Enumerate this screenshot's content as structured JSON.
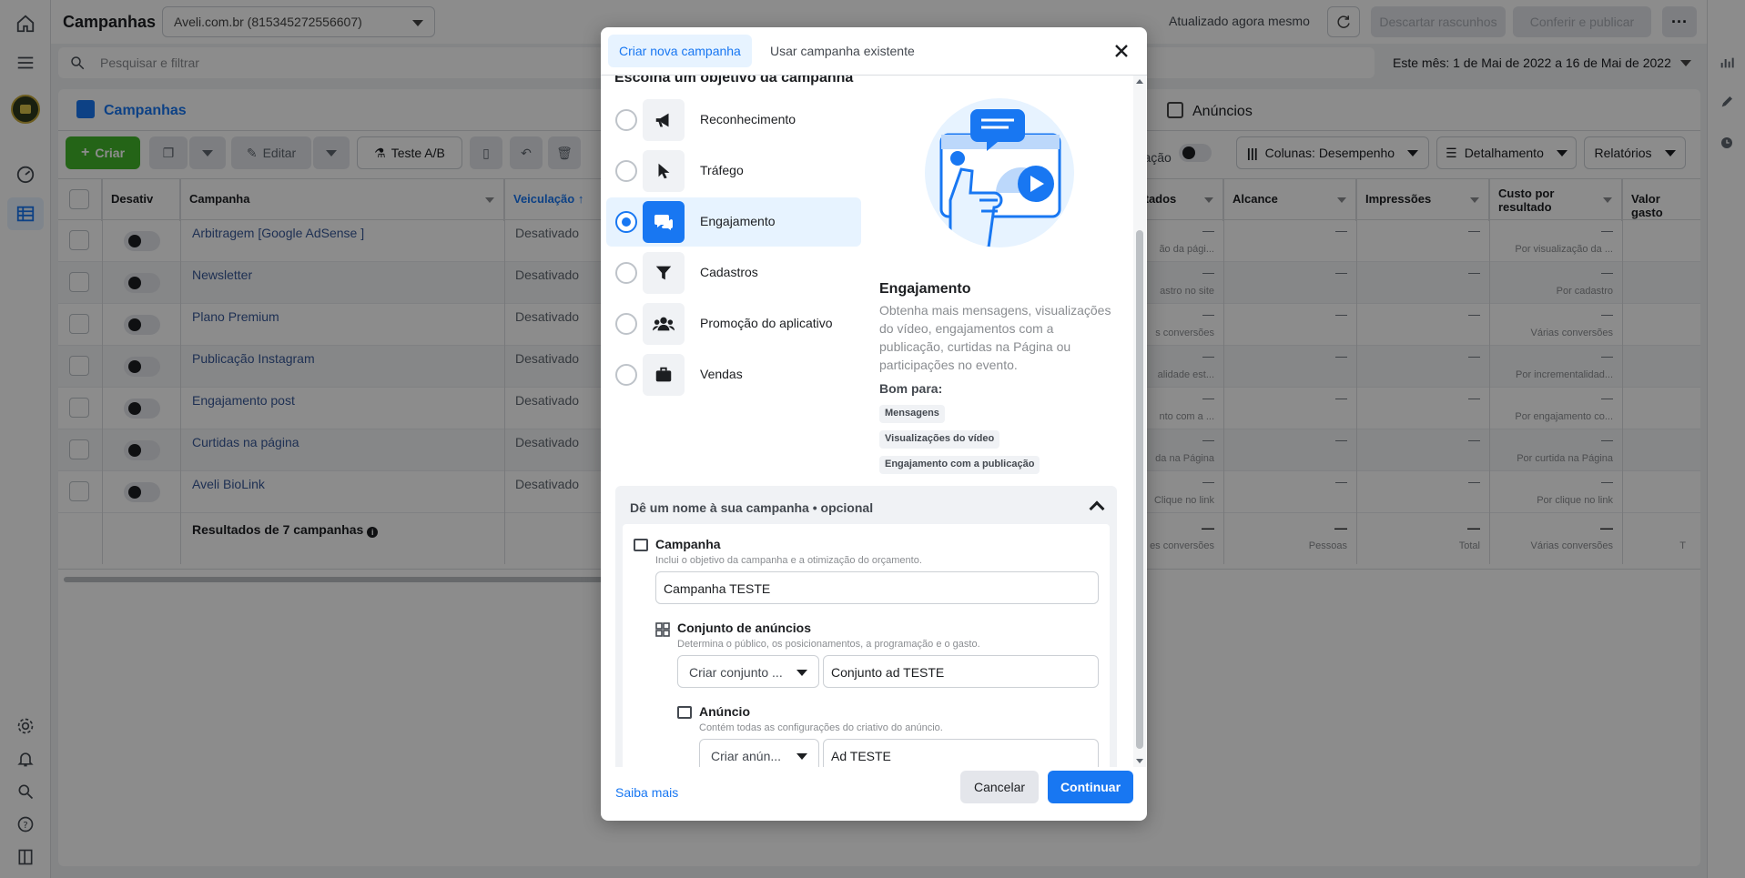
{
  "header": {
    "title": "Campanhas",
    "account": "Aveli.com.br (815345272556607)",
    "updated": "Atualizado agora mesmo",
    "discard": "Descartar rascunhos",
    "review": "Conferir e publicar"
  },
  "search": {
    "placeholder": "Pesquisar e filtrar"
  },
  "date_range": "Este mês: 1 de Mai de 2022 a 16 de Mai de 2022",
  "tabs": {
    "campaigns": "Campanhas",
    "ads": "Anúncios"
  },
  "toolbar": {
    "create": "Criar",
    "edit": "Editar",
    "ab_test": "Teste A/B",
    "duration_fragment": "uração",
    "columns": "Colunas: Desempenho",
    "breakdown": "Detalhamento",
    "reports": "Relatórios"
  },
  "table": {
    "headers": {
      "off": "Desativ",
      "campaign": "Campanha",
      "delivery": "Veiculação",
      "results": "ltados",
      "reach": "Alcance",
      "impressions": "Impressões",
      "cost_per": "Custo por resultado",
      "spent": "Valor gasto"
    },
    "rows": [
      {
        "name": "Arbitragem [Google AdSense ]",
        "delivery": "Desativado",
        "res": "—",
        "res_sub": "ão da pági...",
        "reach": "—",
        "impr": "—",
        "cost": "—",
        "cost_sub": "Por visualização da ..."
      },
      {
        "name": "Newsletter",
        "delivery": "Desativado",
        "res": "—",
        "res_sub": "astro no site",
        "reach": "—",
        "impr": "—",
        "cost": "—",
        "cost_sub": "Por cadastro"
      },
      {
        "name": "Plano Premium",
        "delivery": "Desativado",
        "res": "—",
        "res_sub": "s conversões",
        "reach": "—",
        "impr": "—",
        "cost": "—",
        "cost_sub": "Várias conversões"
      },
      {
        "name": "Publicação Instagram",
        "delivery": "Desativado",
        "res": "—",
        "res_sub": "alidade est...",
        "reach": "—",
        "impr": "—",
        "cost": "—",
        "cost_sub": "Por incrementalidad..."
      },
      {
        "name": "Engajamento post",
        "delivery": "Desativado",
        "res": "—",
        "res_sub": "nto com a ...",
        "reach": "—",
        "impr": "—",
        "cost": "—",
        "cost_sub": "Por engajamento co..."
      },
      {
        "name": "Curtidas na página",
        "delivery": "Desativado",
        "res": "—",
        "res_sub": "da na Página",
        "reach": "—",
        "impr": "—",
        "cost": "—",
        "cost_sub": "Por curtida na Página"
      },
      {
        "name": "Aveli BioLink",
        "delivery": "Desativado",
        "res": "—",
        "res_sub": "Clique no link",
        "reach": "—",
        "impr": "—",
        "cost": "—",
        "cost_sub": "Por clique no link"
      }
    ],
    "summary": {
      "label": "Resultados de 7 campanhas",
      "res": "—",
      "res_sub": "es conversões",
      "reach": "—",
      "reach_sub": "Pessoas",
      "impr": "—",
      "impr_sub": "Total",
      "cost": "—",
      "cost_sub": "Várias conversões",
      "spent_sub": "T"
    }
  },
  "modal": {
    "tab_new": "Criar nova campanha",
    "tab_existing": "Usar campanha existente",
    "objective_heading": "Escolha um objetivo da campanha",
    "objectives": [
      {
        "label": "Reconhecimento",
        "icon": "megaphone-icon"
      },
      {
        "label": "Tráfego",
        "icon": "cursor-icon"
      },
      {
        "label": "Engajamento",
        "icon": "chat-icon",
        "selected": true
      },
      {
        "label": "Cadastros",
        "icon": "funnel-icon"
      },
      {
        "label": "Promoção do aplicativo",
        "icon": "people-icon"
      },
      {
        "label": "Vendas",
        "icon": "briefcase-icon"
      }
    ],
    "detail": {
      "title": "Engajamento",
      "description": "Obtenha mais mensagens, visualizações do vídeo, engajamentos com a publicação, curtidas na Página ou participações no evento.",
      "good_for": "Bom para:",
      "chips": [
        "Mensagens",
        "Visualizações do vídeo",
        "Engajamento com a publicação"
      ]
    },
    "naming": {
      "heading": "Dê um nome à sua campanha • opcional",
      "campaign_title": "Campanha",
      "campaign_desc": "Inclui o objetivo da campanha e a otimização do orçamento.",
      "campaign_value": "Campanha TESTE",
      "adset_title": "Conjunto de anúncios",
      "adset_desc": "Determina o público, os posicionamentos, a programação e o gasto.",
      "adset_select": "Criar conjunto ...",
      "adset_value": "Conjunto ad TESTE",
      "ad_title": "Anúncio",
      "ad_desc": "Contém todas as configurações do criativo do anúncio.",
      "ad_select": "Criar anún...",
      "ad_value": "Ad TESTE"
    },
    "footer": {
      "learn_more": "Saiba mais",
      "cancel": "Cancelar",
      "continue": "Continuar"
    }
  },
  "colors": {
    "accent": "#1877f2",
    "create_green": "#42b72a",
    "link": "#385898"
  }
}
